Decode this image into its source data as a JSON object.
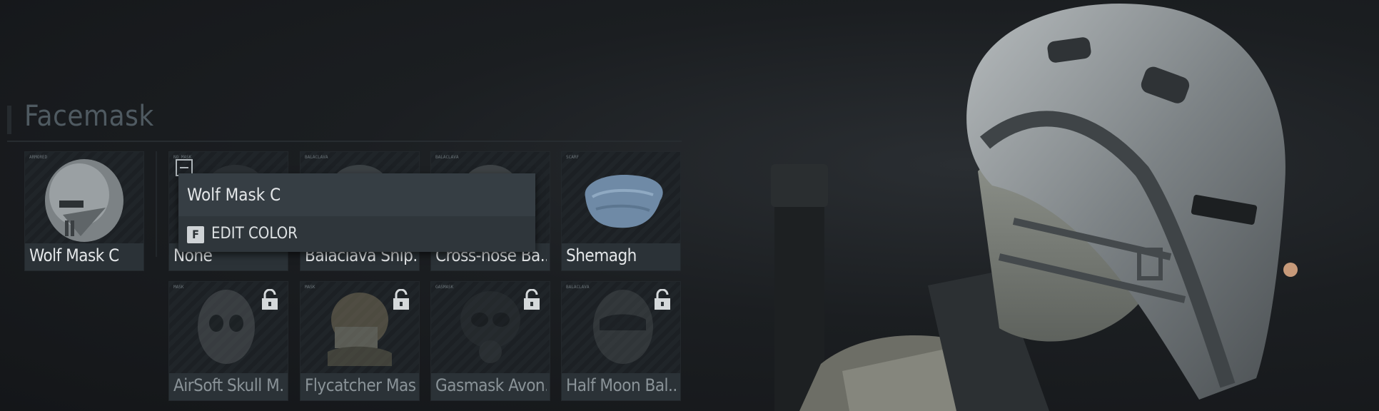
{
  "section": {
    "title": "Facemask"
  },
  "selected": {
    "name": "Wolf Mask C"
  },
  "popup": {
    "title": "Wolf Mask C",
    "key": "F",
    "action": "EDIT COLOR"
  },
  "items": [
    {
      "name": "None",
      "locked": false
    },
    {
      "name": "Balaclava Ship...",
      "locked": false
    },
    {
      "name": "Cross-nose Ba...",
      "locked": false
    },
    {
      "name": "Shemagh",
      "locked": false
    },
    {
      "name": "AirSoft Skull M...",
      "locked": true
    },
    {
      "name": "Flycatcher Mask",
      "locked": true
    },
    {
      "name": "Gasmask Avon...",
      "locked": true
    },
    {
      "name": "Half Moon Bal...",
      "locked": true
    }
  ]
}
